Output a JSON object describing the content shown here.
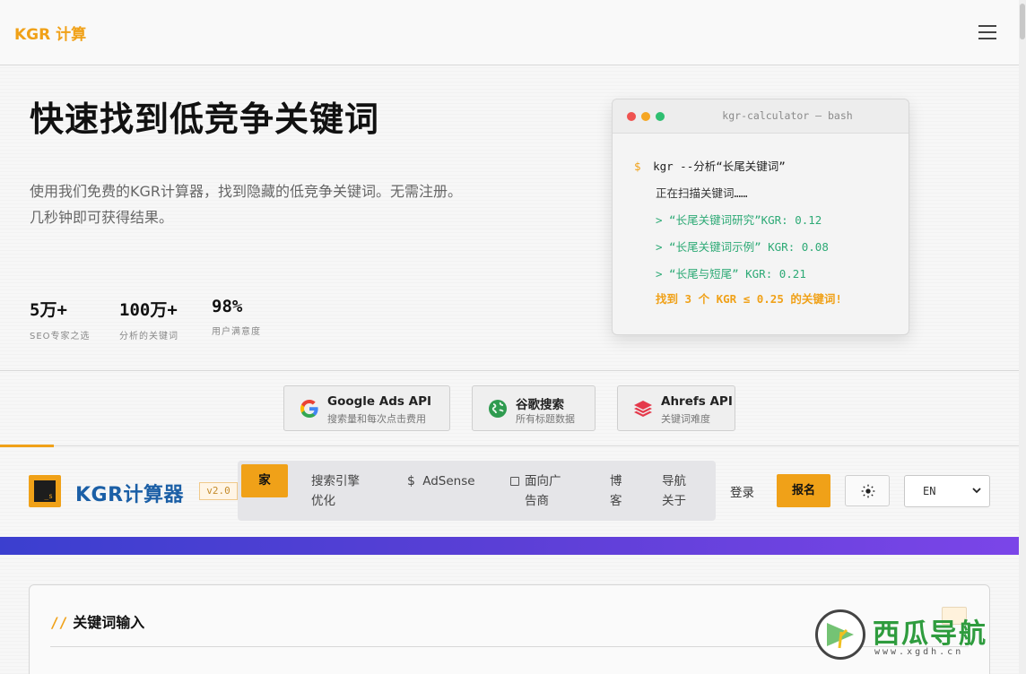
{
  "header": {
    "logo": "KGR 计算"
  },
  "hero": {
    "title": "快速找到低竞争关键词",
    "description": "使用我们免费的KGR计算器，找到隐藏的低竞争关键词。无需注册。几秒钟即可获得结果。",
    "stats": [
      {
        "value": "5万+",
        "label": "SEO专家之选"
      },
      {
        "value": "100万+",
        "label": "分析的关键词"
      },
      {
        "value": "98%",
        "label": "用户满意度"
      }
    ]
  },
  "terminal": {
    "title": "kgr-calculator — bash",
    "prompt": "$",
    "command": "kgr --分析“长尾关键词”",
    "scanning": "正在扫描关键词……",
    "results": [
      "> “长尾关键词研究”KGR: 0.12",
      "> “长尾关键词示例” KGR: 0.08",
      "> “长尾与短尾” KGR: 0.21"
    ],
    "summary": "找到 3 个 KGR ≤ 0.25 的关键词!"
  },
  "apis": [
    {
      "title": "Google Ads API",
      "subtitle": "搜索量和每次点击费用",
      "icon": "google-icon"
    },
    {
      "title": "谷歌搜索",
      "subtitle": "所有标题数据",
      "icon": "globe-icon"
    },
    {
      "title": "Ahrefs API",
      "subtitle": "关键词难度",
      "icon": "layers-icon"
    }
  ],
  "app": {
    "title": "KGR计算器",
    "version": "v2.0",
    "logo_glyph": "_s",
    "nav": {
      "home": "家",
      "search_engine_1": "搜索引擎",
      "search_engine_2": "优化",
      "adsense": "AdSense",
      "ad_1": "面向广",
      "ad_2": "告商",
      "blog_1": "博",
      "blog_2": "客",
      "nav_1": "导航",
      "nav_2": "关于"
    },
    "login": "登录",
    "signup": "报名",
    "language": "EN"
  },
  "panel": {
    "title": "关键词输入",
    "prefix": "//"
  },
  "watermark": {
    "text": "西瓜导航",
    "url": "www.xgdh.cn"
  },
  "colors": {
    "accent": "#f0a118",
    "green": "#2eaa76",
    "brand_blue": "#1b5fa6",
    "purple": "#5b3fd6"
  }
}
